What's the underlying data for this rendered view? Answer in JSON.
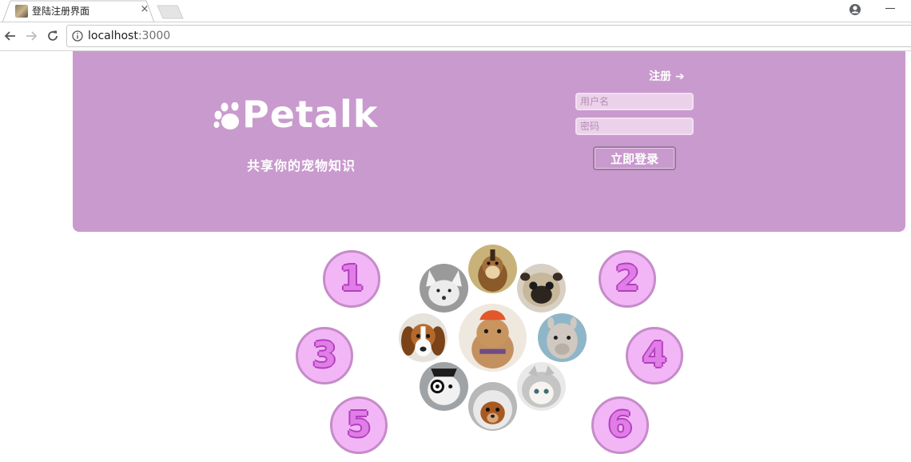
{
  "browser": {
    "tab_title": "登陆注册界面",
    "tab_close": "×",
    "url_host": "localhost",
    "url_port": ":3000"
  },
  "hero": {
    "logo_text": "Petalk",
    "tagline": "共享你的宠物知识",
    "register_link": "注册 ➔",
    "username_placeholder": "用户名",
    "password_placeholder": "密码",
    "login_button": "立即登录",
    "background_color": "#c99acd"
  },
  "numbers": [
    "1",
    "2",
    "3",
    "4",
    "5",
    "6"
  ],
  "animals": [
    {
      "name": "chipmunk"
    },
    {
      "name": "white-fox"
    },
    {
      "name": "pug"
    },
    {
      "name": "beagle"
    },
    {
      "name": "hamster-center"
    },
    {
      "name": "alpaca"
    },
    {
      "name": "monocle-dog"
    },
    {
      "name": "hooded-cat"
    },
    {
      "name": "astronaut-dog"
    }
  ]
}
